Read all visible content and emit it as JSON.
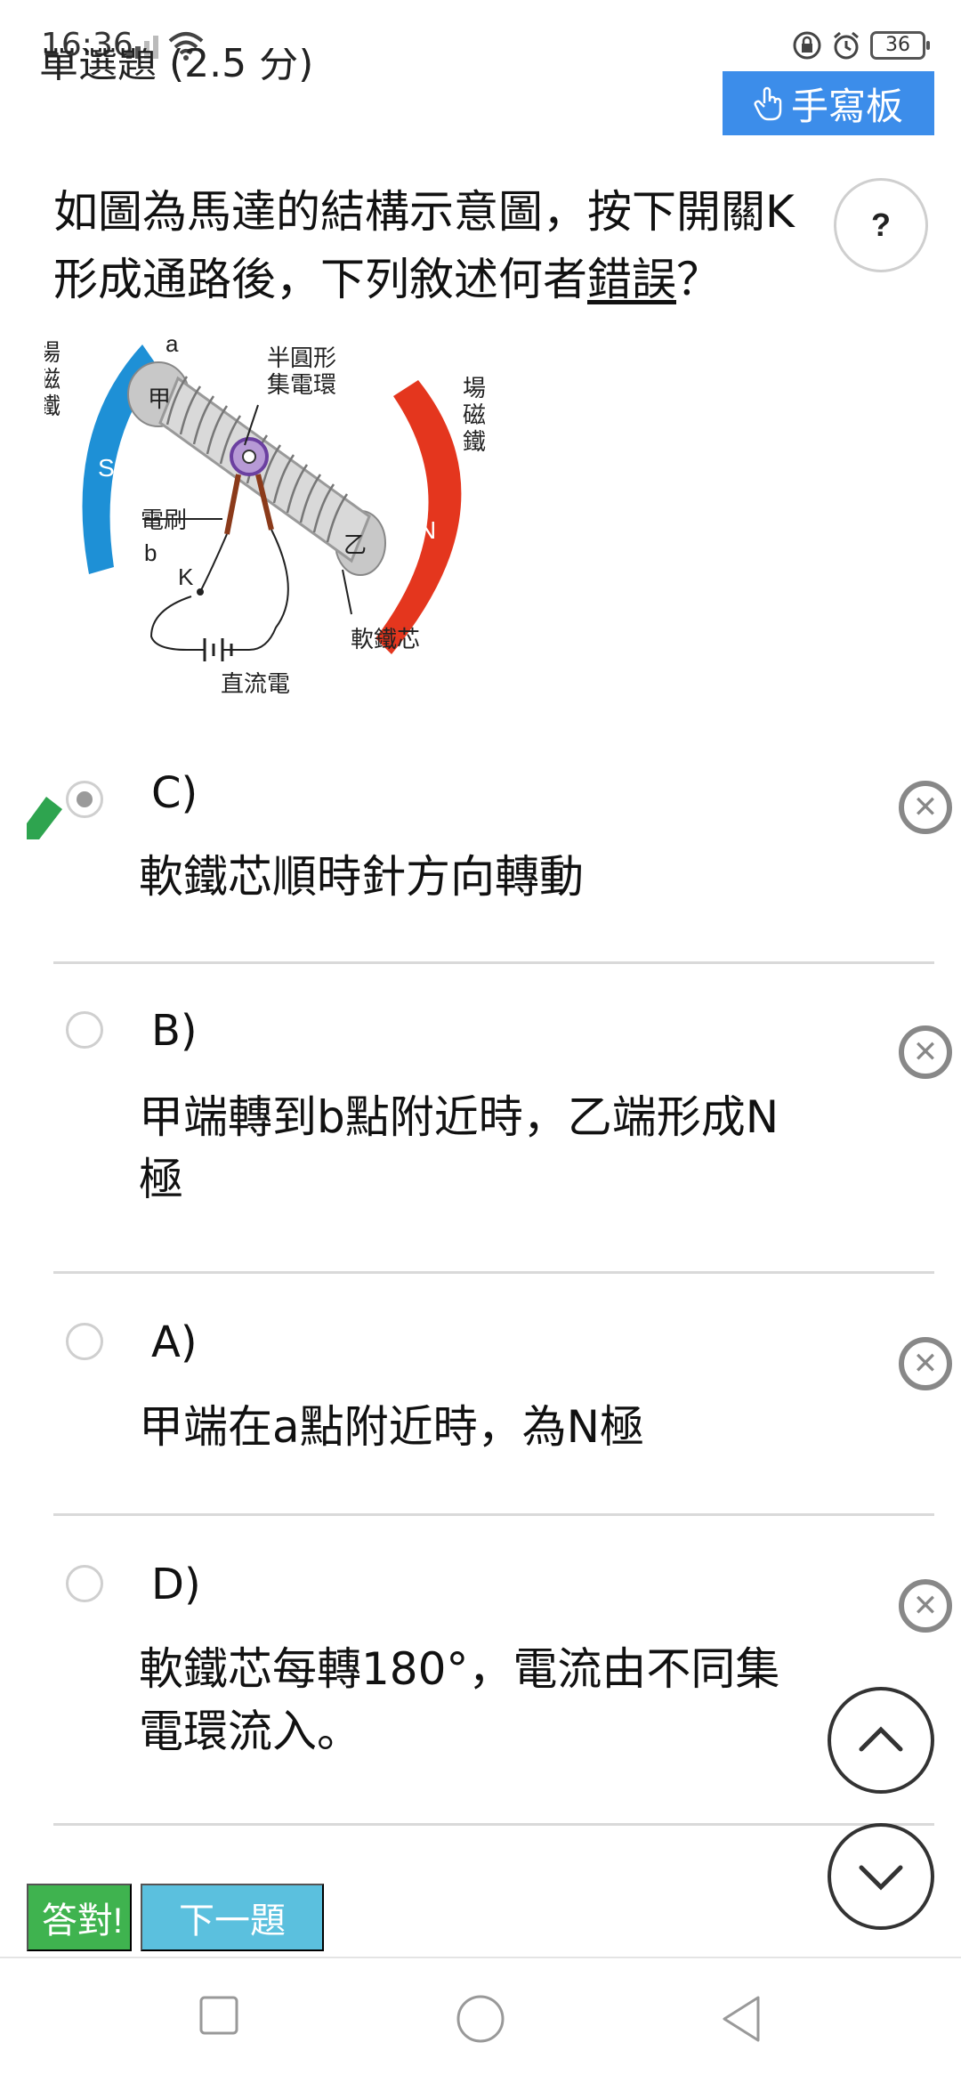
{
  "status_bar": {
    "time": "16:36",
    "battery": "36"
  },
  "header": {
    "question_type": "單選題 (2.5 分)",
    "handwrite_label": "手寫板"
  },
  "question": {
    "text_before": "如圖為馬達的結構示意圖，按下開關K形成通路後，下列敘述何者",
    "text_underlined": "錯誤",
    "text_after": "？",
    "help_label": "?"
  },
  "diagram": {
    "left_magnet_label": "場磁鐵",
    "right_magnet_label": "場磁鐵",
    "left_pole": "S",
    "right_pole": "N",
    "point_a": "a",
    "point_b": "b",
    "end_jia": "甲",
    "end_yi": "乙",
    "commutator_label_1": "半圓形",
    "commutator_label_2": "集電環",
    "brush_label": "電刷",
    "switch_label": "K",
    "dc_label": "直流電",
    "core_label": "軟鐵芯"
  },
  "options": [
    {
      "letter": "C)",
      "text": "軟鐵芯順時針方向轉動",
      "selected": true
    },
    {
      "letter": "B)",
      "text": "甲端轉到b點附近時，乙端形成N極",
      "selected": false
    },
    {
      "letter": "A)",
      "text": "甲端在a點附近時，為N極",
      "selected": false
    },
    {
      "letter": "D)",
      "text": "軟鐵芯每轉180°，電流由不同集電環流入。",
      "selected": false
    }
  ],
  "buttons": {
    "answer_label": "答對!",
    "next_label": "下一題"
  },
  "colors": {
    "accent_blue": "#3c8dea",
    "green": "#3fb34f",
    "light_blue": "#5bc0de",
    "magnet_s": "#1e90d6",
    "magnet_n": "#e4361e"
  }
}
